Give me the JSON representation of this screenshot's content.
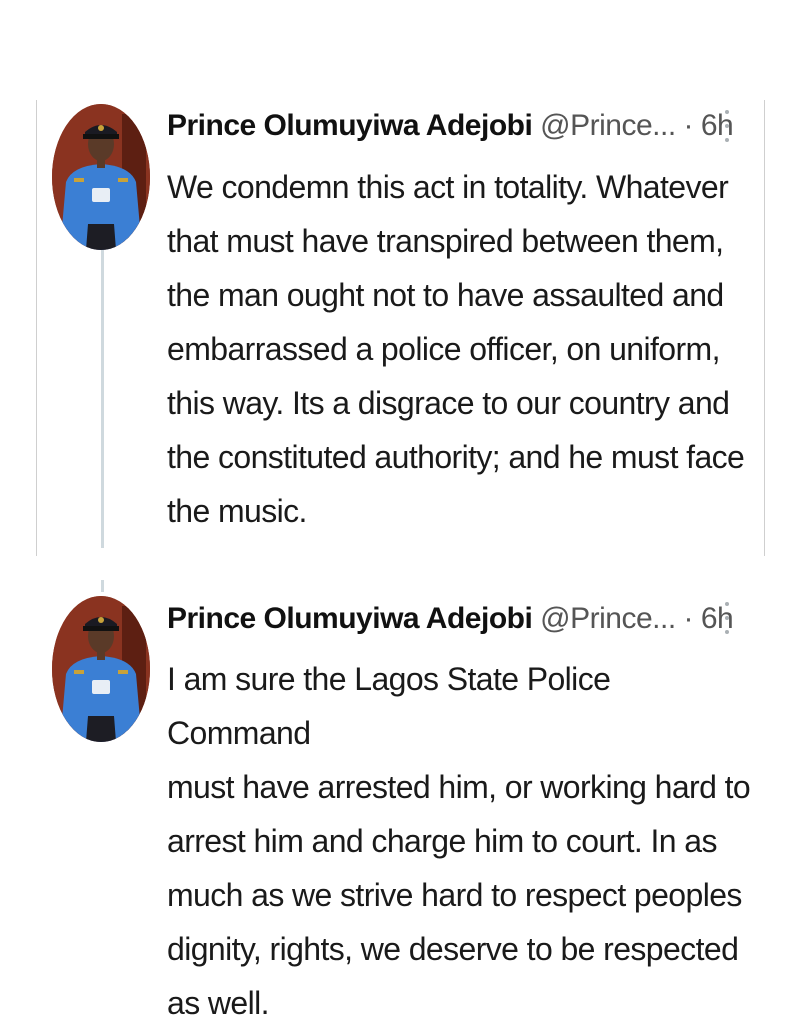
{
  "tweets": [
    {
      "author_name": "Prince Olumuyiwa Adejobi",
      "handle": "@Prince...",
      "separator": "·",
      "time": "6h",
      "avatar_icon": "police-officer-avatar",
      "more_icon": "more-vertical-icon",
      "text": "We condemn this act in totality. Whatever\nthat must have transpired between them,\nthe man ought not to have assaulted and\nembarrassed a police officer, on uniform,\nthis way. Its a disgrace to our country and\nthe constituted authority; and he must face\nthe music."
    },
    {
      "author_name": "Prince Olumuyiwa Adejobi",
      "handle": "@Prince...",
      "separator": "·",
      "time": "6h",
      "avatar_icon": "police-officer-avatar",
      "more_icon": "more-vertical-icon",
      "text": "I am sure the Lagos State Police Command\nmust have arrested him, or working hard to\narrest him and charge him to court. In as\nmuch as we strive hard to respect peoples\ndignity, rights, we deserve to be respected\nas well."
    }
  ],
  "colors": {
    "text": "#1a1a1a",
    "secondary": "#555555",
    "thread_line": "#cfd9de",
    "uniform_blue": "#3b7fd4"
  }
}
